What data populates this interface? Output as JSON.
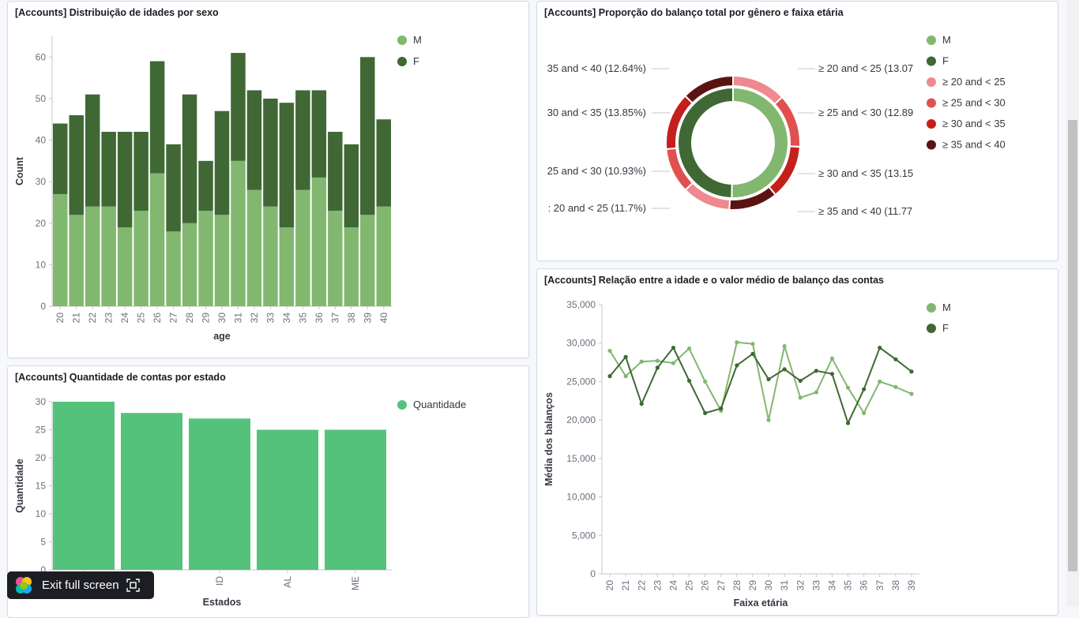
{
  "panels": {
    "p1": {
      "title": "[Accounts] Distribuição de idades por sexo"
    },
    "p2": {
      "title": "[Accounts] Proporção do balanço total por gênero e faixa etária"
    },
    "p3": {
      "title": "[Accounts] Quantidade de contas por estado"
    },
    "p4": {
      "title": "[Accounts] Relação entre a idade e o valor médio de balanço das contas"
    }
  },
  "exit_fullscreen": {
    "label": "Exit full screen"
  },
  "colors": {
    "m": "#82b76f",
    "f": "#3f6835",
    "state_bar": "#54c27b",
    "r1": "#f0888f",
    "r2": "#e0504e",
    "r3": "#c51f1b",
    "r4": "#5b1311"
  },
  "chart_data": [
    {
      "type": "bar",
      "stacked": true,
      "categories": [
        "20",
        "21",
        "22",
        "23",
        "24",
        "25",
        "26",
        "27",
        "28",
        "29",
        "30",
        "31",
        "32",
        "33",
        "34",
        "35",
        "36",
        "37",
        "38",
        "39",
        "40"
      ],
      "series": [
        {
          "name": "M",
          "values": [
            27,
            22,
            24,
            24,
            19,
            23,
            32,
            18,
            20,
            23,
            22,
            35,
            28,
            24,
            19,
            28,
            31,
            23,
            19,
            22,
            24
          ]
        },
        {
          "name": "F",
          "values": [
            17,
            24,
            27,
            18,
            23,
            19,
            27,
            21,
            31,
            12,
            25,
            26,
            24,
            26,
            30,
            24,
            21,
            19,
            20,
            38,
            21
          ]
        }
      ],
      "xlabel": "age",
      "ylabel": "Count",
      "yticks": [
        "0",
        "10",
        "20",
        "30",
        "40",
        "50",
        "60"
      ],
      "ylim": [
        0,
        65
      ],
      "legend_position": "top-right"
    },
    {
      "type": "pie",
      "donut": true,
      "inner": [
        {
          "name": "M",
          "value": 50.4
        },
        {
          "name": "F",
          "value": 49.6
        }
      ],
      "outer": [
        {
          "name": "≥ 20 and < 25",
          "value": 13.07
        },
        {
          "name": "≥ 25 and < 30",
          "value": 12.89
        },
        {
          "name": "≥ 30 and < 35",
          "value": 13.15
        },
        {
          "name": "≥ 35 and < 40",
          "value": 11.77
        },
        {
          "name": "≥ 20 and < 25",
          "value": 11.7
        },
        {
          "name": "≥ 25 and < 30",
          "value": 10.93
        },
        {
          "name": "≥ 30 and < 35",
          "value": 13.85
        },
        {
          "name": "≥ 35 and < 40",
          "value": 12.64
        }
      ],
      "slice_labels_right": [
        "≥ 20 and < 25 (13.07",
        "≥ 25 and < 30 (12.89",
        "≥ 30 and < 35 (13.15",
        "≥ 35 and < 40 (11.77"
      ],
      "slice_labels_left": [
        "35 and < 40 (12.64%)",
        "30 and < 35 (13.85%)",
        "25 and < 30 (10.93%)",
        ": 20 and < 25 (11.7%)"
      ],
      "legend": [
        "M",
        "F",
        "≥ 20 and < 25",
        "≥ 25 and < 30",
        "≥ 30 and < 35",
        "≥ 35 and < 40"
      ],
      "legend_position": "right"
    },
    {
      "type": "bar",
      "categories": [
        "",
        "",
        "ID",
        "AL",
        "ME"
      ],
      "series": [
        {
          "name": "Quantidade",
          "values": [
            30,
            28,
            27,
            25,
            25
          ]
        }
      ],
      "xlabel": "Estados",
      "ylabel": "Quantidade",
      "yticks": [
        "0",
        "5",
        "10",
        "15",
        "20",
        "25",
        "30"
      ],
      "ylim": [
        0,
        30
      ],
      "legend_position": "top-right"
    },
    {
      "type": "line",
      "x": [
        "20",
        "21",
        "22",
        "23",
        "24",
        "25",
        "26",
        "27",
        "28",
        "29",
        "30",
        "31",
        "32",
        "33",
        "34",
        "35",
        "36",
        "37",
        "38",
        "39"
      ],
      "series": [
        {
          "name": "M",
          "values": [
            29000,
            25700,
            27600,
            27700,
            27400,
            29300,
            25000,
            21200,
            30100,
            29900,
            20000,
            29600,
            22900,
            23600,
            28000,
            24200,
            20900,
            25000,
            24300,
            23400
          ]
        },
        {
          "name": "F",
          "values": [
            25700,
            28200,
            22100,
            26800,
            29400,
            25100,
            20900,
            21500,
            27100,
            28600,
            25300,
            26600,
            25100,
            26400,
            26000,
            19600,
            24000,
            29400,
            27900,
            26300
          ]
        }
      ],
      "xlabel": "Faixa etária",
      "ylabel": "Média dos balanços",
      "yticks": [
        "0",
        "5,000",
        "10,000",
        "15,000",
        "20,000",
        "25,000",
        "30,000",
        "35,000"
      ],
      "ylim": [
        0,
        35000
      ],
      "legend_position": "top-right"
    }
  ]
}
